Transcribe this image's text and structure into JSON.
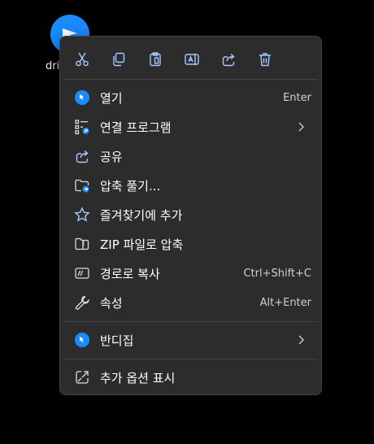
{
  "desktop": {
    "label": "dri"
  },
  "toolbar": [
    "cut-icon",
    "copy-icon",
    "paste-icon",
    "rename-icon",
    "share-icon",
    "delete-icon"
  ],
  "menu": {
    "items": [
      {
        "label": "열기",
        "shortcut": "Enter"
      },
      {
        "label": "연결 프로그램",
        "submenu": true
      },
      {
        "label": "공유"
      },
      {
        "label": "압축 풀기..."
      },
      {
        "label": "즐겨찾기에 추가"
      },
      {
        "label": "ZIP 파일로 압축"
      },
      {
        "label": "경로로 복사",
        "shortcut": "Ctrl+Shift+C"
      },
      {
        "label": "속성",
        "shortcut": "Alt+Enter"
      },
      {
        "label": "반디집",
        "submenu": true
      },
      {
        "label": "추가 옵션 표시"
      }
    ]
  },
  "colors": {
    "menu_bg": "#2c2c2c",
    "accent": "#1a8cff",
    "icon": "#a8c8ff"
  }
}
